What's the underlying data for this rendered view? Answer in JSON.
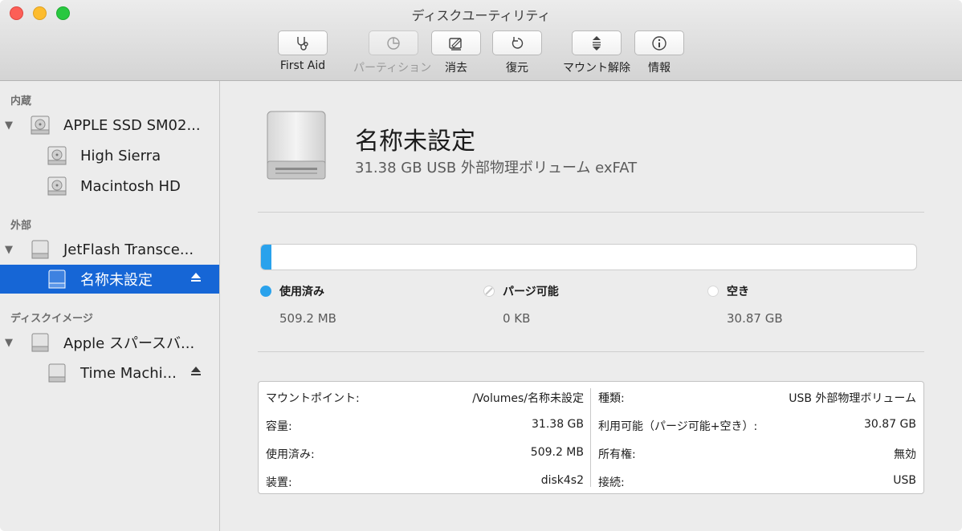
{
  "window": {
    "title": "ディスクユーティリティ"
  },
  "toolbar": {
    "first_aid": "First Aid",
    "partition": "パーティション",
    "erase": "消去",
    "restore": "復元",
    "unmount": "マウント解除",
    "info": "情報"
  },
  "sidebar": {
    "sections": [
      "内蔵",
      "外部",
      "ディスクイメージ"
    ],
    "items": [
      {
        "label": "APPLE SSD SM02...",
        "icon": "internal-disk-icon"
      },
      {
        "label": "High Sierra",
        "icon": "internal-volume-icon"
      },
      {
        "label": "Macintosh HD",
        "icon": "internal-volume-icon"
      },
      {
        "label": "JetFlash Transce...",
        "icon": "external-disk-icon"
      },
      {
        "label": "名称未設定",
        "icon": "external-volume-icon",
        "selected": true
      },
      {
        "label": "Apple スパースバ...",
        "icon": "disk-image-icon"
      },
      {
        "label": "Time Machi...",
        "icon": "disk-image-volume-icon"
      }
    ]
  },
  "volume": {
    "name": "名称未設定",
    "subtitle": "31.38 GB USB 外部物理ボリューム exFAT"
  },
  "usage": {
    "used_fraction": 0.0162,
    "legend": [
      {
        "label": "使用済み",
        "value": "509.2 MB",
        "color": "#2aa2ec"
      },
      {
        "label": "パージ可能",
        "value": "0 KB",
        "color": "#ffffff"
      },
      {
        "label": "空き",
        "value": "30.87 GB",
        "color": "#ffffff"
      }
    ]
  },
  "info": {
    "left": [
      {
        "key": "マウントポイント:",
        "value": "/Volumes/名称未設定"
      },
      {
        "key": "容量:",
        "value": "31.38 GB"
      },
      {
        "key": "使用済み:",
        "value": "509.2 MB"
      },
      {
        "key": "装置:",
        "value": "disk4s2"
      }
    ],
    "right": [
      {
        "key": "種類:",
        "value": "USB 外部物理ボリューム"
      },
      {
        "key": "利用可能（パージ可能+空き）:",
        "value": "30.87 GB"
      },
      {
        "key": "所有権:",
        "value": "無効"
      },
      {
        "key": "接続:",
        "value": "USB"
      }
    ]
  },
  "colors": {
    "accent": "#1666d6",
    "usage_blue": "#2aa2ec"
  }
}
